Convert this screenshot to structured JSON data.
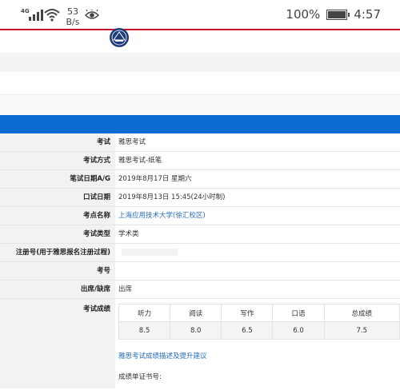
{
  "status_bar": {
    "network": "4G",
    "speed_value": "53",
    "speed_unit": "B/s",
    "battery": "100%",
    "time": "4:57"
  },
  "colors": {
    "accent_blue": "#0b6ad2",
    "top_red": "#c8102e",
    "link": "#2a6ebd"
  },
  "details": {
    "exam_label": "考试",
    "exam_value": "雅思考试",
    "method_label": "考试方式",
    "method_value": "雅思考试-纸笔",
    "written_date_label": "笔试日期A/G",
    "written_date_value": "2019年8月17日 星期六",
    "oral_date_label": "口试日期",
    "oral_date_value": "2019年8月13日 15:45(24小时制)",
    "venue_label": "考点名称",
    "venue_value": "上海应用技术大学(徐汇校区)",
    "type_label": "考试类型",
    "type_value": "学术类",
    "reg_label": "注册号(用于雅思报名注册过程)",
    "candidate_label": "考号",
    "attendance_label": "出席/缺席",
    "attendance_value": "出席",
    "scores_label": "考试成绩"
  },
  "scores": {
    "headers": [
      "听力",
      "阅读",
      "写作",
      "口语",
      "总成绩"
    ],
    "values": [
      "8.5",
      "8.0",
      "6.5",
      "6.0",
      "7.5"
    ]
  },
  "links": {
    "advice": "雅思考试成绩描述及提升建议"
  },
  "report": {
    "label": "成绩单证书号:"
  }
}
